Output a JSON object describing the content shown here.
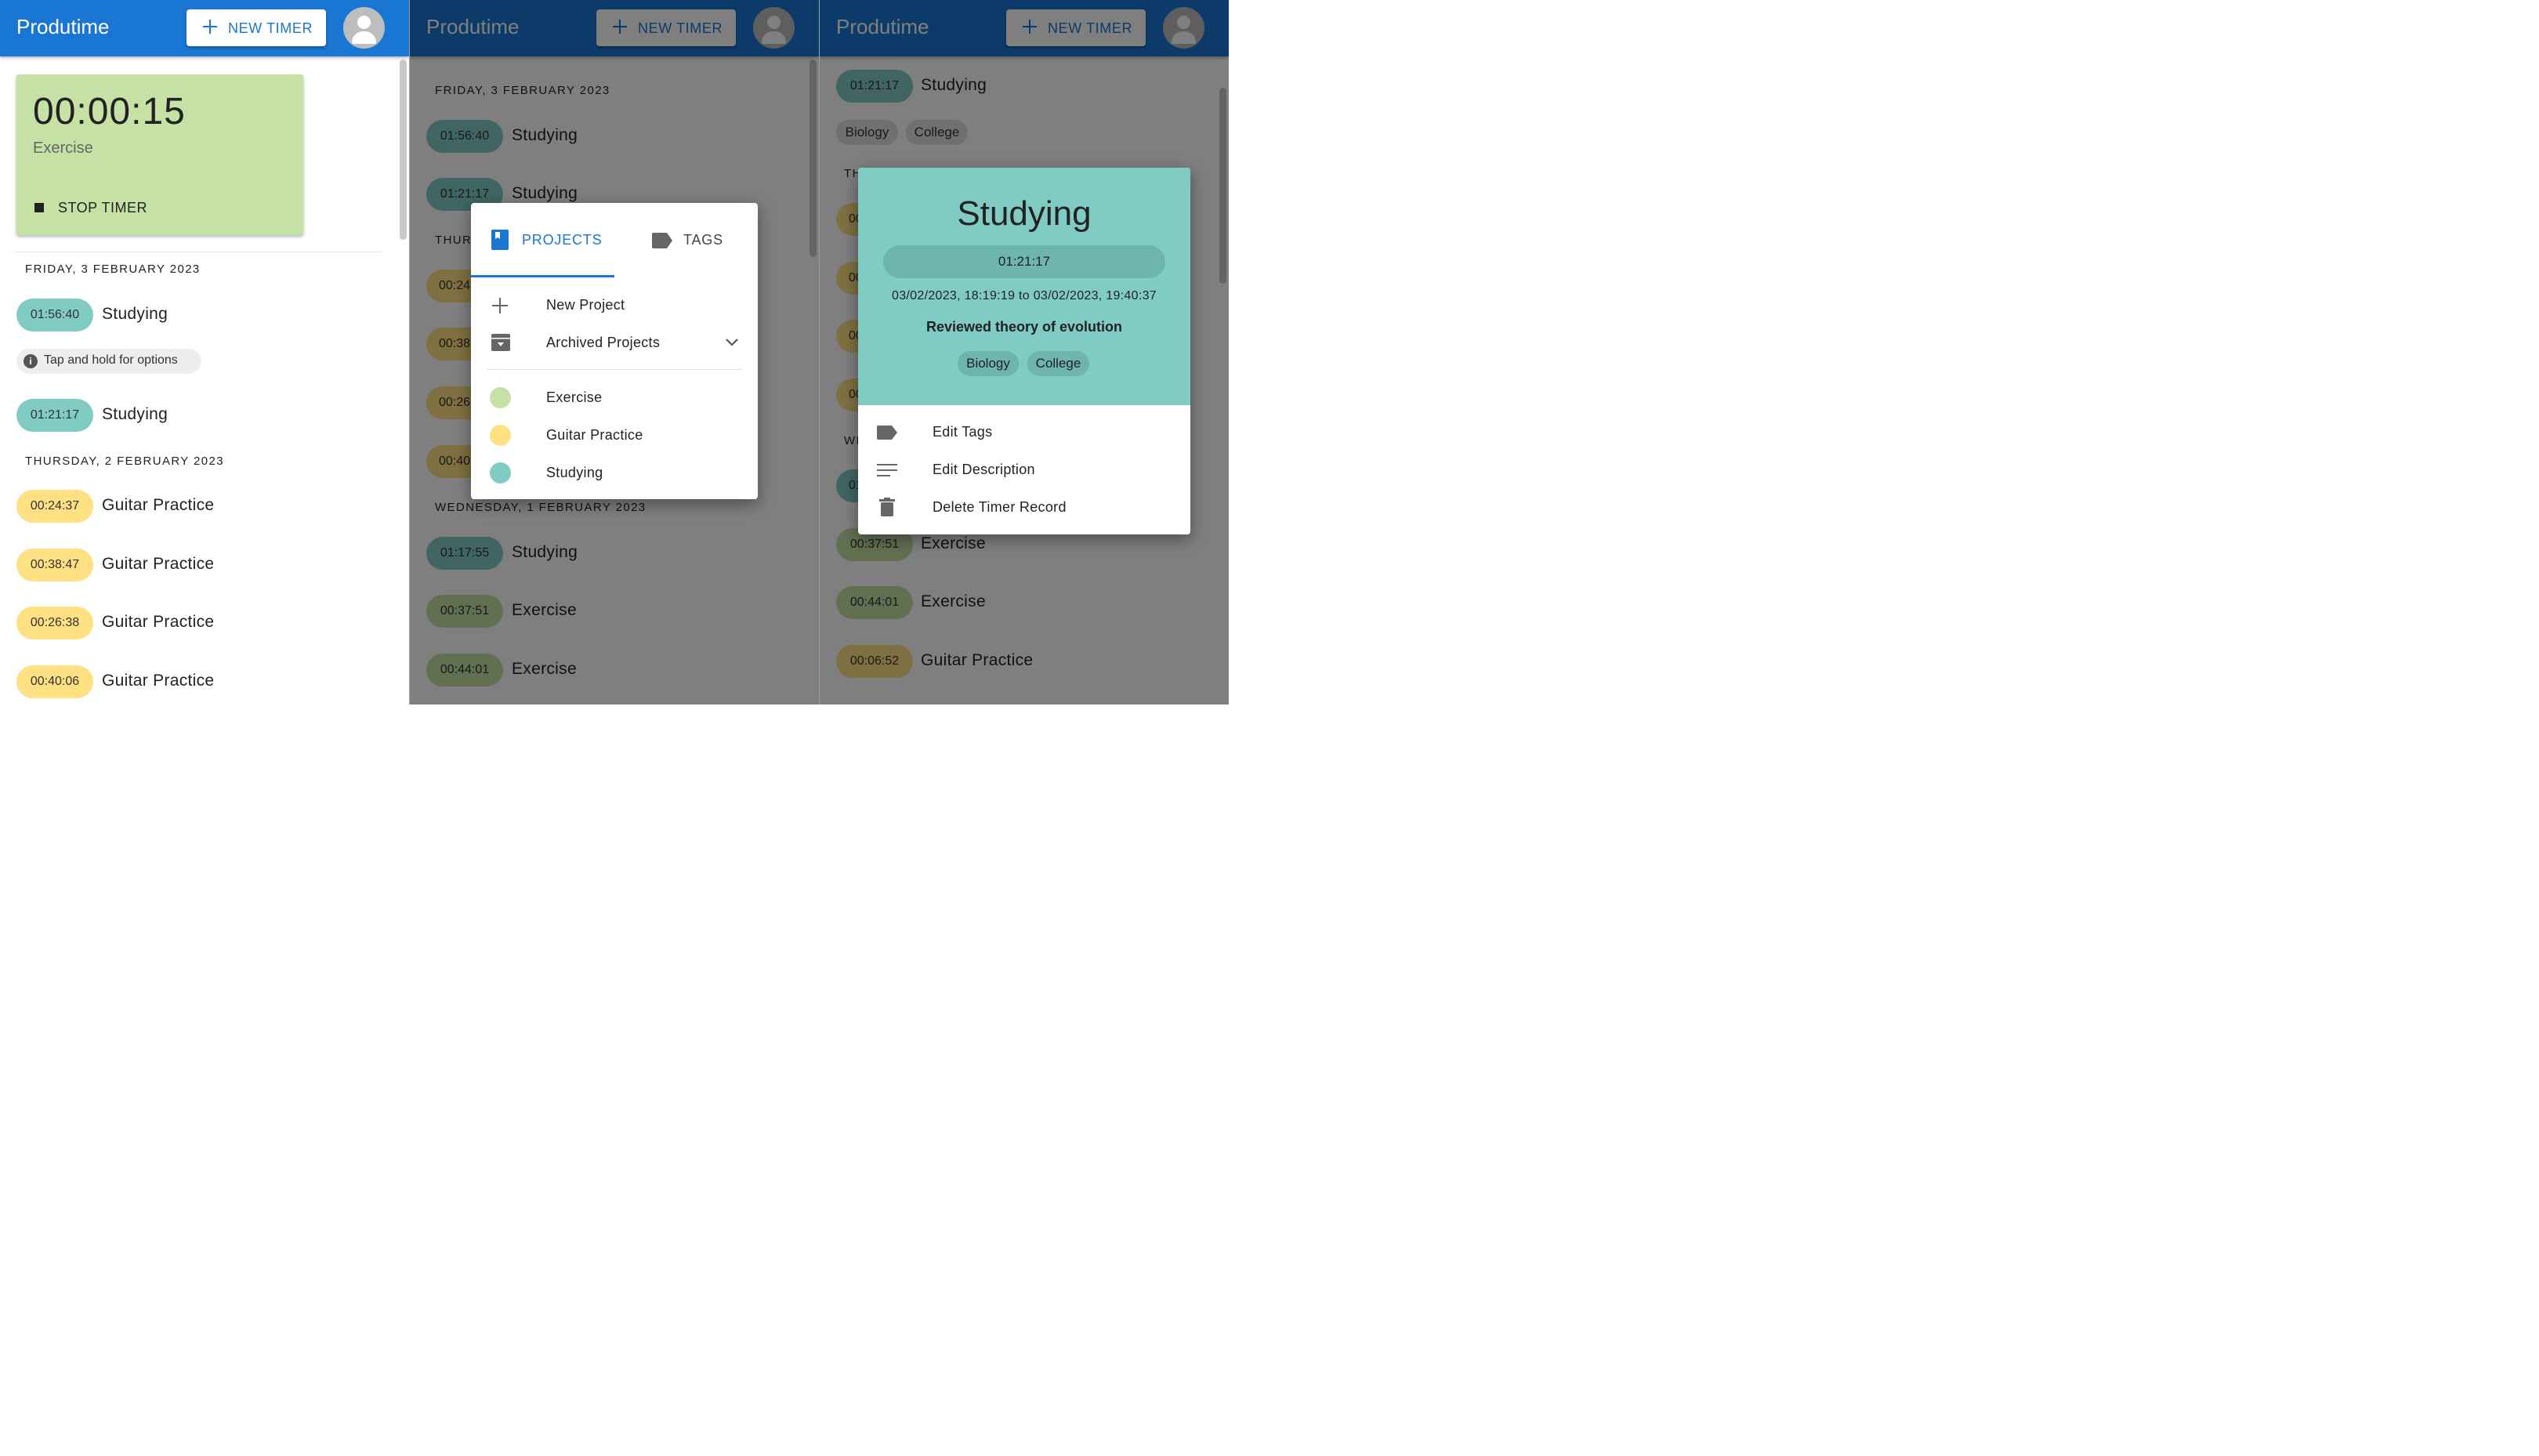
{
  "app": {
    "title": "Produtime",
    "new_timer_label": "NEW TIMER"
  },
  "running_timer": {
    "time": "00:00:15",
    "project": "Exercise",
    "stop_label": "STOP TIMER"
  },
  "hint": {
    "icon": "info-icon",
    "text": "Tap and hold for options"
  },
  "panel1": {
    "day1": "FRIDAY, 3 FEBRUARY 2023",
    "day1_entries": [
      {
        "duration": "01:56:40",
        "title": "Studying"
      },
      {
        "duration": "01:21:17",
        "title": "Studying"
      }
    ],
    "day2": "THURSDAY, 2 FEBRUARY 2023",
    "day2_entries": [
      {
        "duration": "00:24:37",
        "title": "Guitar Practice"
      },
      {
        "duration": "00:38:47",
        "title": "Guitar Practice"
      },
      {
        "duration": "00:26:38",
        "title": "Guitar Practice"
      },
      {
        "duration": "00:40:06",
        "title": "Guitar Practice"
      }
    ]
  },
  "panel2": {
    "day1": "FRIDAY, 3 FEBRUARY 2023",
    "day1_entries": [
      {
        "duration": "01:56:40",
        "title": "Studying"
      },
      {
        "duration": "01:21:17",
        "title": "Studying"
      }
    ],
    "day2_partial": "THUR",
    "day2_chips": [
      "00:24",
      "00:38",
      "00:26",
      "00:40"
    ],
    "day3": "WEDNESDAY, 1 FEBRUARY 2023",
    "day3_entries": [
      {
        "duration": "01:17:55",
        "title": "Studying"
      },
      {
        "duration": "00:37:51",
        "title": "Exercise"
      },
      {
        "duration": "00:44:01",
        "title": "Exercise"
      }
    ]
  },
  "project_dialog": {
    "tabs": [
      {
        "label": "PROJECTS",
        "icon": "book-icon",
        "active": true
      },
      {
        "label": "TAGS",
        "icon": "label-icon",
        "active": false
      }
    ],
    "new_project": "New Project",
    "archived": "Archived Projects",
    "projects": [
      {
        "name": "Exercise",
        "color": "#c5e1a5"
      },
      {
        "name": "Guitar Practice",
        "color": "#ffe082"
      },
      {
        "name": "Studying",
        "color": "#80cbc4"
      }
    ]
  },
  "panel3": {
    "top_entry": {
      "duration": "01:21:17",
      "title": "Studying"
    },
    "top_tags": [
      "Biology",
      "College"
    ],
    "partial_date1": "TH",
    "partial_chips": [
      "00",
      "00",
      "00",
      "00"
    ],
    "partial_date2": "WI",
    "partial_chip2": "01",
    "lower_entries": [
      {
        "duration": "00:37:51",
        "title": "Exercise"
      },
      {
        "duration": "00:44:01",
        "title": "Exercise"
      },
      {
        "duration": "00:06:52",
        "title": "Guitar Practice"
      }
    ]
  },
  "timer_detail": {
    "title": "Studying",
    "duration": "01:21:17",
    "range": "03/02/2023, 18:19:19 to 03/02/2023, 19:40:37",
    "description": "Reviewed theory of evolution",
    "tags": [
      "Biology",
      "College"
    ],
    "actions": [
      {
        "label": "Edit Tags",
        "icon": "label-icon"
      },
      {
        "label": "Edit Description",
        "icon": "notes-icon"
      },
      {
        "label": "Delete Timer Record",
        "icon": "trash-icon"
      }
    ]
  },
  "colors": {
    "primary": "#1976d2",
    "studying": "#80cbc4",
    "guitar": "#ffe082",
    "exercise": "#c5e1a5"
  }
}
